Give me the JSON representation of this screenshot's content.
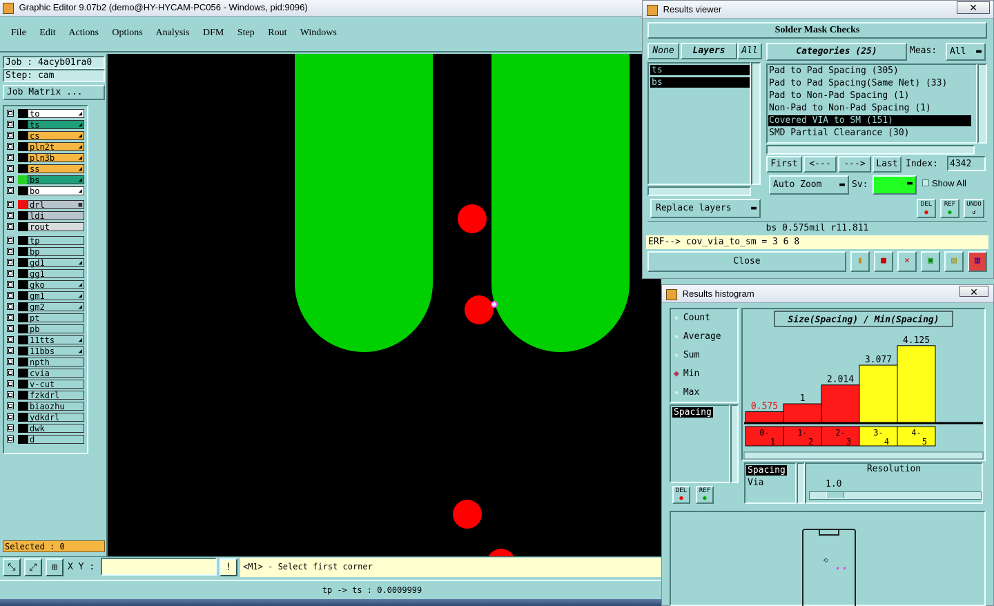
{
  "main_window": {
    "title": "Graphic Editor 9.07b2 (demo@HY-HYCAM-PC056 - Windows, pid:9096)",
    "menu": [
      "File",
      "Edit",
      "Actions",
      "Options",
      "Analysis",
      "DFM",
      "Step",
      "Rout",
      "Windows"
    ],
    "job_label": "Job  : 4acyb01ra0",
    "step_label": "Step: cam",
    "job_matrix_button": "Job Matrix ...",
    "selected_label": "Selected : 0",
    "xy_label": "X Y :",
    "xy_value": "",
    "status_hint": "<M1> - Select first corner",
    "bottom_status": "tp -> ts : 0.0009999"
  },
  "layers": [
    {
      "name": "to",
      "color": "#ffffff",
      "indicator": "#000000",
      "marker": "◢"
    },
    {
      "name": "ts",
      "color": "#1fa07a",
      "indicator": "#000000",
      "marker": "◢"
    },
    {
      "name": "cs",
      "color": "#f5b642",
      "indicator": "#000000",
      "marker": "◢"
    },
    {
      "name": "pln2t",
      "color": "#f5b642",
      "indicator": "#000000",
      "marker": "◢"
    },
    {
      "name": "pln3b",
      "color": "#f5b642",
      "indicator": "#000000",
      "marker": "◢"
    },
    {
      "name": "ss",
      "color": "#f5b642",
      "indicator": "#000000",
      "marker": "◢"
    },
    {
      "name": "bs",
      "color": "#1fa07a",
      "indicator": "#28d428",
      "marker": "◢"
    },
    {
      "name": "bo",
      "color": "#ffffff",
      "indicator": "#000000",
      "marker": "◢"
    }
  ],
  "drill_layers": [
    {
      "name": "drl",
      "color": "#b8c4cc",
      "indicator": "#ee1111",
      "marker": "▦"
    },
    {
      "name": "ldi",
      "color": "#b8c4cc",
      "indicator": "#000000",
      "marker": ""
    },
    {
      "name": "rout",
      "color": "#d8dcdc",
      "indicator": "#000000",
      "marker": ""
    }
  ],
  "misc_layers": [
    {
      "name": "tp",
      "marker": ""
    },
    {
      "name": "bp",
      "marker": ""
    },
    {
      "name": "gd1",
      "marker": "◢"
    },
    {
      "name": "gg1",
      "marker": ""
    },
    {
      "name": "gko",
      "marker": "◢"
    },
    {
      "name": "gm1",
      "marker": "◢"
    },
    {
      "name": "gm2",
      "marker": "◢"
    },
    {
      "name": "pt",
      "marker": ""
    },
    {
      "name": "pb",
      "marker": ""
    },
    {
      "name": "11tts",
      "marker": "◢"
    },
    {
      "name": "11bbs",
      "marker": "◢"
    },
    {
      "name": "npth",
      "marker": ""
    },
    {
      "name": "cvia",
      "marker": ""
    },
    {
      "name": "v-cut",
      "marker": ""
    },
    {
      "name": "fzkdrl",
      "marker": ""
    },
    {
      "name": "biaozhu",
      "marker": ""
    },
    {
      "name": "ydkdrl",
      "marker": ""
    },
    {
      "name": "dwk",
      "marker": ""
    },
    {
      "name": "d",
      "marker": ""
    }
  ],
  "results_viewer": {
    "title": "Results viewer",
    "header": "Solder Mask Checks",
    "none_btn": "None",
    "layers_btn": "Layers",
    "all_btn": "All",
    "layers_list": [
      "ts",
      "bs"
    ],
    "categories_btn": "Categories (25)",
    "meas_label": "Meas:",
    "meas_value": "All",
    "categories": [
      "Pad to Pad Spacing (305)",
      "Pad to Pad Spacing(Same Net) (33)",
      "Pad to Non-Pad Spacing (1)",
      "Non-Pad to Non-Pad Spacing (1)",
      "Covered VIA to SM (151)",
      "SMD Partial Clearance (30)"
    ],
    "selected_category_index": 4,
    "first_btn": "First",
    "prev_btn": "<---",
    "next_btn": "--->",
    "last_btn": "Last",
    "index_label": "Index:",
    "index_value": "4342",
    "auto_zoom": "Auto Zoom",
    "sv_label": "Sv:",
    "show_all": "Show All",
    "replace_layers": "Replace layers",
    "del_label": "DEL",
    "ref_label": "REF",
    "undo_label": "UNDO",
    "measure_line": "bs 0.575mil  r11.811",
    "erf_line": "ERF--> cov_via_to_sm = 3 6 8",
    "close_btn": "Close"
  },
  "histogram": {
    "title": "Results histogram",
    "modes": [
      "Count",
      "Average",
      "Sum",
      "Min",
      "Max"
    ],
    "selected_mode": "Min",
    "list_items": [
      "Spacing"
    ],
    "attr_list": [
      "Spacing",
      "Via"
    ],
    "resolution_label": "Resolution",
    "resolution_value": "1.0",
    "del_label": "DEL",
    "ref_label": "REF"
  },
  "chart_data": {
    "type": "bar",
    "title": "Size(Spacing) / Min(Spacing)",
    "categories": [
      "0-1",
      "1-2",
      "2-3",
      "3-4",
      "4-5"
    ],
    "values": [
      0.575,
      1,
      2.014,
      3.077,
      4.125
    ],
    "value_labels": [
      "0.575",
      "1",
      "2.014",
      "3.077",
      "4.125"
    ],
    "colors": [
      "#ff1a1a",
      "#ff1a1a",
      "#ff1a1a",
      "#ffff1a",
      "#ffff1a"
    ],
    "ylim": [
      0,
      4.6
    ]
  },
  "colors": {
    "panel": "#9fd6d4",
    "canvas": "#000000",
    "pad_green": "#00d000",
    "via_red": "#ff0000",
    "highlight_yellow": "#ffffd0"
  }
}
